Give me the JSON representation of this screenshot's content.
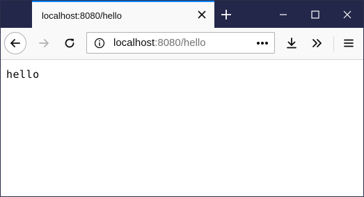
{
  "browser": {
    "tab": {
      "title": "localhost:8080/hello"
    },
    "url": {
      "host": "localhost",
      "rest": ":8080/hello"
    }
  },
  "icons": {
    "tab_close": "close-icon",
    "new_tab": "plus-icon",
    "minimize": "minimize-icon",
    "maximize": "maximize-icon",
    "close_window": "close-icon",
    "back": "arrow-left-icon",
    "forward": "arrow-right-icon",
    "reload": "reload-icon",
    "site_info": "info-icon",
    "page_actions": "ellipsis-icon",
    "downloads": "download-icon",
    "overflow": "chevron-double-right-icon",
    "menu": "hamburger-icon"
  },
  "colors": {
    "titlebar": "#23284a",
    "tab_accent": "#0a84ff",
    "toolbar": "#f9f9fa"
  },
  "page": {
    "body_text": "hello"
  }
}
